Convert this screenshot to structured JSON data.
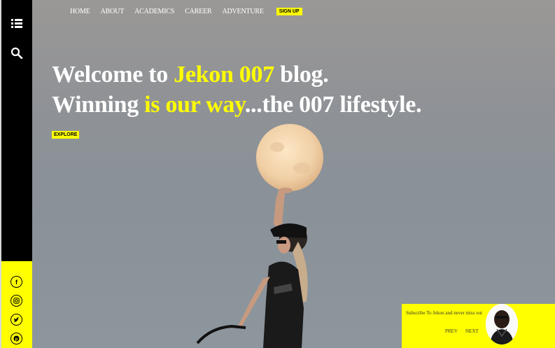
{
  "nav": {
    "items": [
      "HOME",
      "ABOUT",
      "ACADEMICS",
      "CAREER",
      "ADVENTURE"
    ],
    "signup_label": "SIGN UP"
  },
  "sidebar": {
    "menu_icon": "list-icon",
    "search_icon": "search-icon",
    "social": [
      {
        "icon": "facebook-icon",
        "glyph": "f"
      },
      {
        "icon": "instagram-icon",
        "glyph": "◎"
      },
      {
        "icon": "twitter-icon",
        "glyph": "t"
      },
      {
        "icon": "pinterest-icon",
        "glyph": "p"
      }
    ]
  },
  "hero": {
    "line1_a": "Welcome to ",
    "line1_b": "Jekon 007",
    "line1_c": " blog.",
    "line2_a": "Winning ",
    "line2_b": "is our way",
    "line2_c": "...the 007 lifestyle.",
    "explore_label": "EXPLORE"
  },
  "subscribe": {
    "text": "Subscribe To Jekon and never miss out",
    "prev_label": "PREV",
    "next_label": "NEXT"
  },
  "colors": {
    "accent": "#ffff00",
    "sidebar": "#000000",
    "text": "#ffffff"
  }
}
